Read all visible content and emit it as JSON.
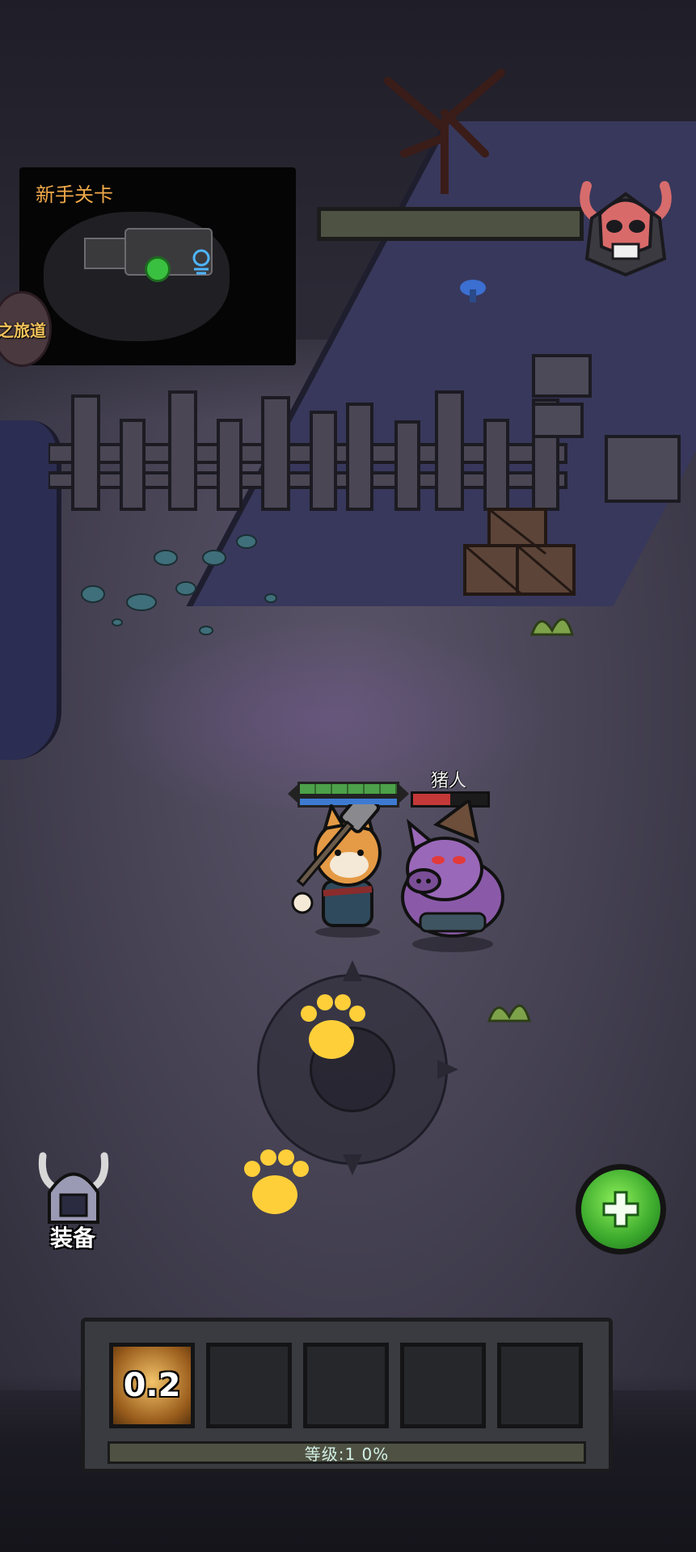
{
  "minimap": {
    "title": "新手关卡"
  },
  "side_badge": {
    "label": "之旅道"
  },
  "boss": {
    "hp_fraction": 0
  },
  "player": {
    "hp_fraction": 1.0,
    "mp_fraction": 1.0
  },
  "enemy": {
    "name": "猪人",
    "hp_fraction": 0.5
  },
  "equip_button": {
    "label": "装备"
  },
  "skill_bar": {
    "slot1_value": "0.2",
    "level_text": "等级:1  0%"
  },
  "colors": {
    "minimap_title": "#f0a94a",
    "player_hp": "#4da14a",
    "player_mp": "#3d7bd2",
    "enemy_hp": "#c43838",
    "heal_button": "#3aa82c"
  },
  "icons": {
    "boss": "demon-skull-icon",
    "equip": "horned-helmet-icon",
    "heal": "green-cross-icon",
    "joystick_paw": "paw-icon",
    "minimap_portal": "portal-icon"
  }
}
